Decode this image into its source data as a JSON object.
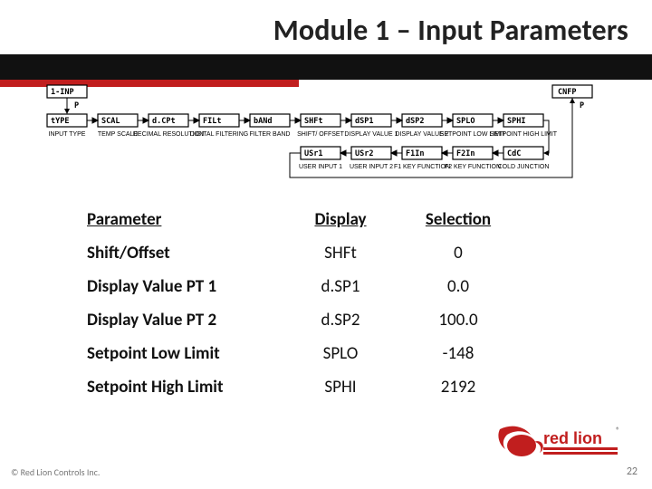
{
  "title": "Module 1 – Input Parameters",
  "diagram": {
    "entry": {
      "display": "1-INP",
      "p": "P"
    },
    "row1": [
      {
        "display": "tYPE",
        "label": "INPUT TYPE"
      },
      {
        "display": "SCAL",
        "label": "TEMP SCALE"
      },
      {
        "display": "d.CPt",
        "label": "DECIMAL RESOLUTION"
      },
      {
        "display": "FILt",
        "label": "DIGITAL FILTERING"
      },
      {
        "display": "bANd",
        "label": "FILTER BAND"
      },
      {
        "display": "SHFt",
        "label": "SHIFT/ OFFSET"
      },
      {
        "display": "dSP1",
        "label": "DISPLAY VALUE 1"
      },
      {
        "display": "dSP2",
        "label": "DISPLAY VALUE 2"
      },
      {
        "display": "SPLO",
        "label": "SETPOINT LOW LIMIT"
      },
      {
        "display": "SPHI",
        "label": "SETPOINT HIGH LIMIT"
      }
    ],
    "row2": [
      {
        "display": "USr1",
        "label": "USER INPUT 1"
      },
      {
        "display": "USr2",
        "label": "USER INPUT 2"
      },
      {
        "display": "F1In",
        "label": "F1 KEY FUNCTION"
      },
      {
        "display": "F2In",
        "label": "F2 KEY FUNCTION"
      },
      {
        "display": "CdC",
        "label": "COLD JUNCTION"
      }
    ],
    "exit": {
      "display": "CNFP",
      "p": "P"
    }
  },
  "table": {
    "headers": {
      "c1": "Parameter",
      "c2": "Display",
      "c3": "Selection"
    },
    "rows": [
      {
        "param": "Shift/Offset",
        "display": "SHFt",
        "selection": "0"
      },
      {
        "param": "Display Value PT 1",
        "display": "d.SP1",
        "selection": "0.0"
      },
      {
        "param": "Display Value PT 2",
        "display": "d.SP2",
        "selection": "100.0"
      },
      {
        "param": "Setpoint Low Limit",
        "display": "SPLO",
        "selection": "-148"
      },
      {
        "param": "Setpoint High Limit",
        "display": "SPHI",
        "selection": "2192"
      }
    ]
  },
  "footer": "© Red Lion Controls Inc.",
  "pagenum": "22",
  "logo": {
    "brand": "red lion",
    "reg": "®"
  }
}
